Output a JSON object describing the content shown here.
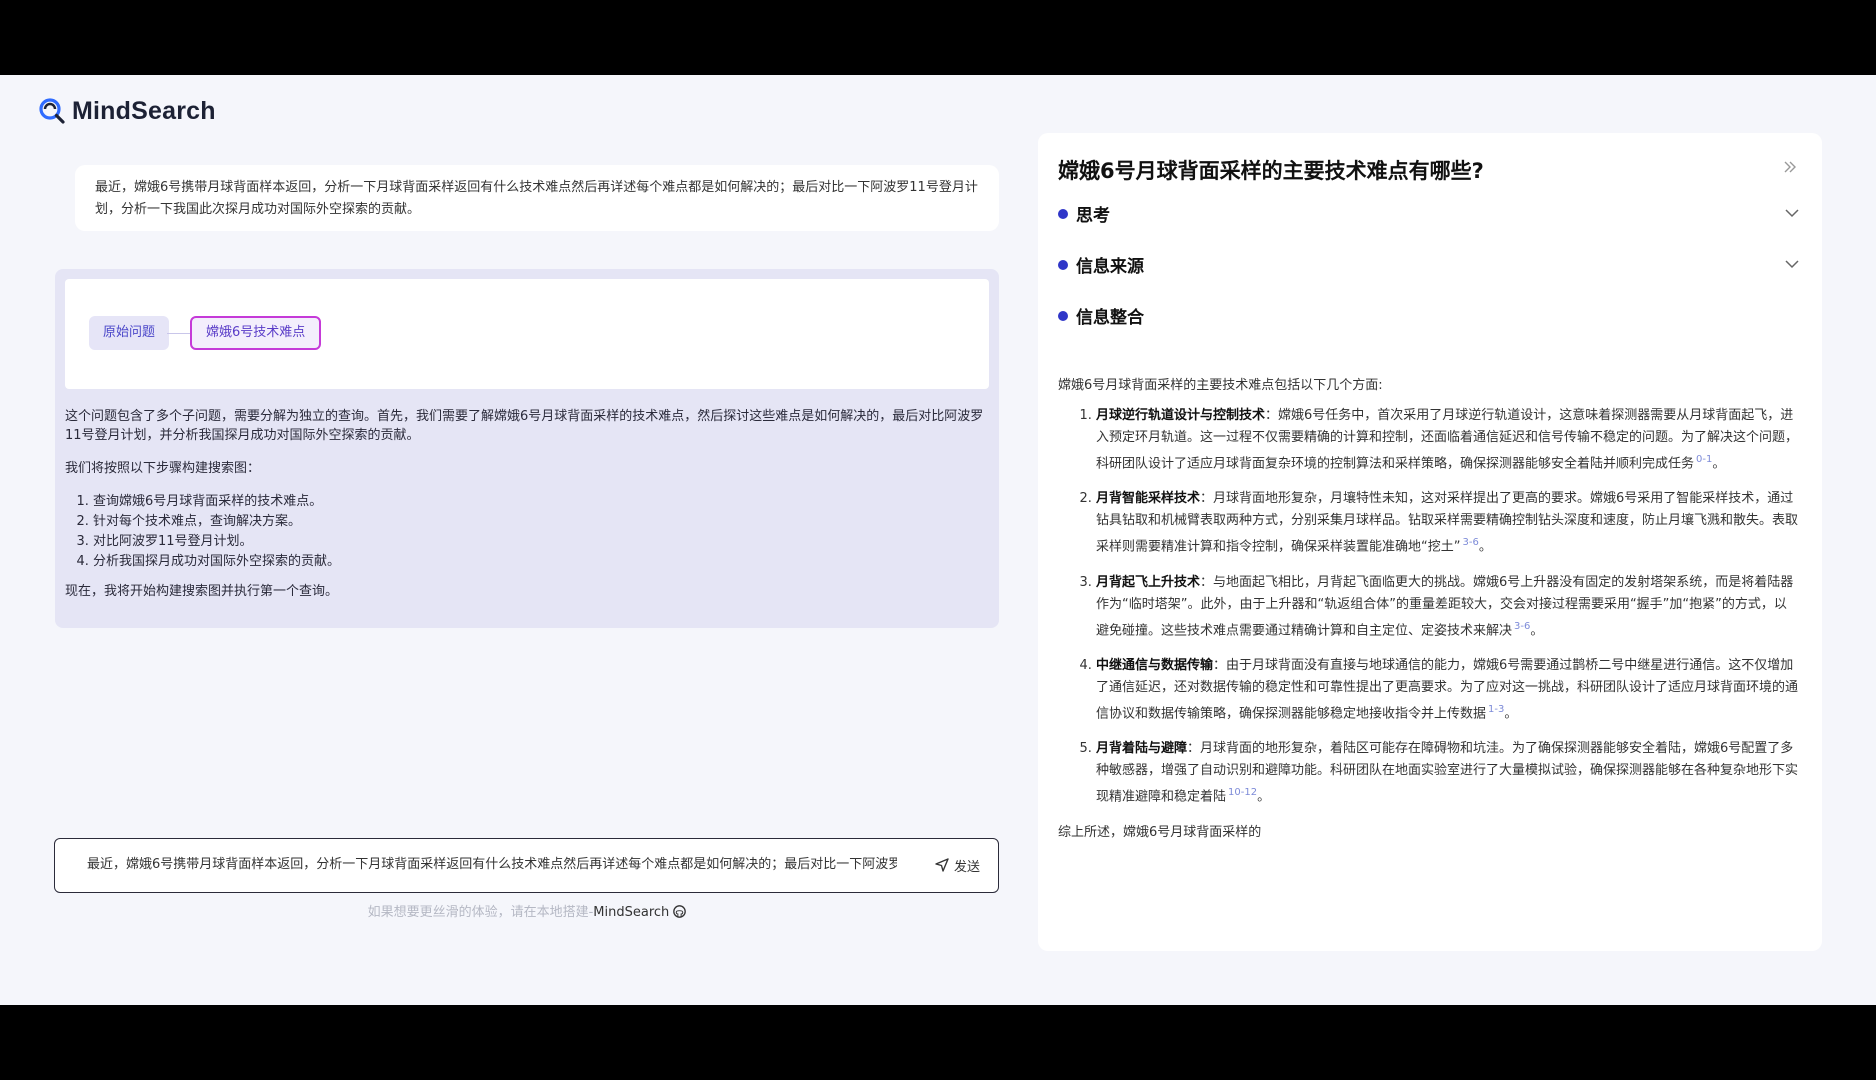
{
  "brand": {
    "name": "MindSearch",
    "accent": "#2f36c8"
  },
  "query": {
    "text": "最近，嫦娥6号携带月球背面样本返回，分析一下月球背面采样返回有什么技术难点然后再详述每个难点都是如何解决的；最后对比一下阿波罗11号登月计划，分析一下我国此次探月成功对国际外空探索的贡献。"
  },
  "graph": {
    "root_label": "原始问题",
    "child_label": "嫦娥6号技术难点"
  },
  "agent": {
    "intro": "这个问题包含了多个子问题，需要分解为独立的查询。首先，我们需要了解嫦娥6号月球背面采样的技术难点，然后探讨这些难点是如何解决的，最后对比阿波罗11号登月计划，并分析我国探月成功对国际外空探索的贡献。",
    "steps_heading": "我们将按照以下步骤构建搜索图：",
    "steps": [
      "查询嫦娥6号月球背面采样的技术难点。",
      "针对每个技术难点，查询解决方案。",
      "对比阿波罗11号登月计划。",
      "分析我国探月成功对国际外空探索的贡献。"
    ],
    "closing": "现在，我将开始构建搜索图并执行第一个查询。"
  },
  "input": {
    "value": "最近，嫦娥6号携带月球背面样本返回，分析一下月球背面采样返回有什么技术难点然后再详述每个难点都是如何解决的；最后对比一下阿波罗",
    "send_label": "发送"
  },
  "footer": {
    "note": "如果想要更丝滑的体验，请在本地搭建-",
    "brand": "MindSearch"
  },
  "panel": {
    "title": "嫦娥6号月球背面采样的主要技术难点有哪些?",
    "sections": {
      "thinking": "思考",
      "sources": "信息来源",
      "integration": "信息整合"
    },
    "answer_intro": "嫦娥6号月球背面采样的主要技术难点包括以下几个方面:",
    "points": [
      {
        "title": "月球逆行轨道设计与控制技术",
        "body": "嫦娥6号任务中，首次采用了月球逆行轨道设计，这意味着探测器需要从月球背面起飞，进入预定环月轨道。这一过程不仅需要精确的计算和控制，还面临着通信延迟和信号传输不稳定的问题。为了解决这个问题，科研团队设计了适应月球背面复杂环境的控制算法和采样策略，确保探测器能够安全着陆并顺利完成任务",
        "ref": "0-1"
      },
      {
        "title": "月背智能采样技术",
        "body": "月球背面地形复杂，月壤特性未知，这对采样提出了更高的要求。嫦娥6号采用了智能采样技术，通过钻具钻取和机械臂表取两种方式，分别采集月球样品。钻取采样需要精确控制钻头深度和速度，防止月壤飞溅和散失。表取采样则需要精准计算和指令控制，确保采样装置能准确地“挖土”",
        "ref": "3-6"
      },
      {
        "title": "月背起飞上升技术",
        "body": "与地面起飞相比，月背起飞面临更大的挑战。嫦娥6号上升器没有固定的发射塔架系统，而是将着陆器作为“临时塔架”。此外，由于上升器和“轨返组合体”的重量差距较大，交会对接过程需要采用“握手”加“抱紧”的方式，以避免碰撞。这些技术难点需要通过精确计算和自主定位、定姿技术来解决",
        "ref": "3-6"
      },
      {
        "title": "中继通信与数据传输",
        "body": "由于月球背面没有直接与地球通信的能力，嫦娥6号需要通过鹊桥二号中继星进行通信。这不仅增加了通信延迟，还对数据传输的稳定性和可靠性提出了更高要求。为了应对这一挑战，科研团队设计了适应月球背面环境的通信协议和数据传输策略，确保探测器能够稳定地接收指令并上传数据",
        "ref": "1-3"
      },
      {
        "title": "月背着陆与避障",
        "body": "月球背面的地形复杂，着陆区可能存在障碍物和坑洼。为了确保探测器能够安全着陆，嫦娥6号配置了多种敏感器，增强了自动识别和避障功能。科研团队在地面实验室进行了大量模拟试验，确保探测器能够在各种复杂地形下实现精准避障和稳定着陆",
        "ref": "10-12"
      }
    ],
    "summary": "综上所述，嫦娥6号月球背面采样的"
  }
}
